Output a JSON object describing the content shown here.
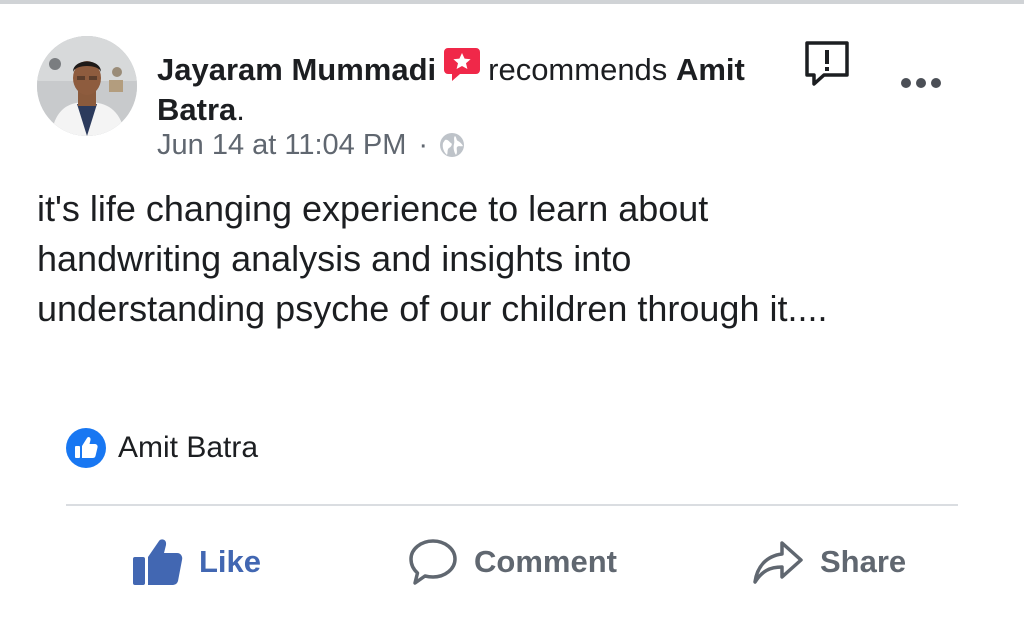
{
  "post": {
    "author_name": "Jayaram Mummadi",
    "recommends_text": "recommends",
    "page_name_part1": "Amit",
    "page_name_part2": "Batra",
    "period": ".",
    "timestamp": "Jun 14 at 11:04 PM",
    "separator": "·",
    "privacy_icon": "globe-icon",
    "body": "it's life changing experience to learn about\nhandwriting analysis and insights into\nunderstanding psyche of our children through it...."
  },
  "reactions": {
    "icon": "like-badge-icon",
    "names": "Amit Batra"
  },
  "actions": {
    "like_label": "Like",
    "comment_label": "Comment",
    "share_label": "Share"
  },
  "colors": {
    "like_blue": "#4267b2",
    "recommend_red": "#f02849",
    "secondary_text": "#606770",
    "divider": "#dadde1"
  }
}
